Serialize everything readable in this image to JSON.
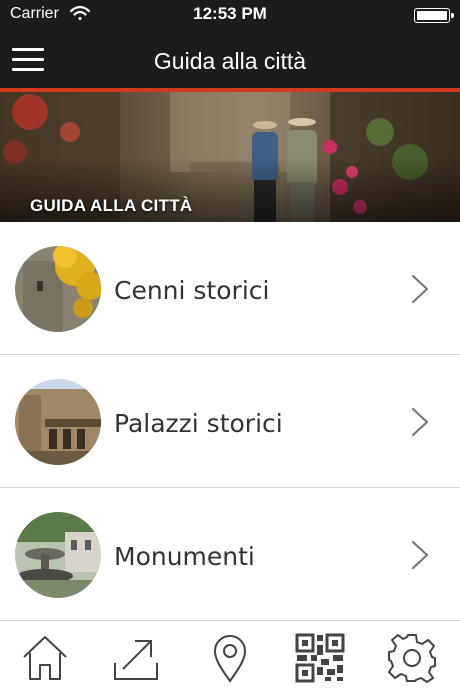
{
  "status_bar": {
    "carrier": "Carrier",
    "time": "12:53 PM"
  },
  "nav": {
    "title": "Guida alla città"
  },
  "banner": {
    "title": "GUIDA ALLA CITTÀ"
  },
  "list": {
    "items": [
      {
        "label": "Cenni storici"
      },
      {
        "label": "Palazzi storici"
      },
      {
        "label": "Monumenti"
      }
    ]
  },
  "tabs": [
    "home-icon",
    "share-icon",
    "location-pin-icon",
    "qr-code-icon",
    "settings-gear-icon"
  ],
  "colors": {
    "bar": "#1c1c1c",
    "accent": "#d23a1e",
    "icon": "#444444"
  }
}
